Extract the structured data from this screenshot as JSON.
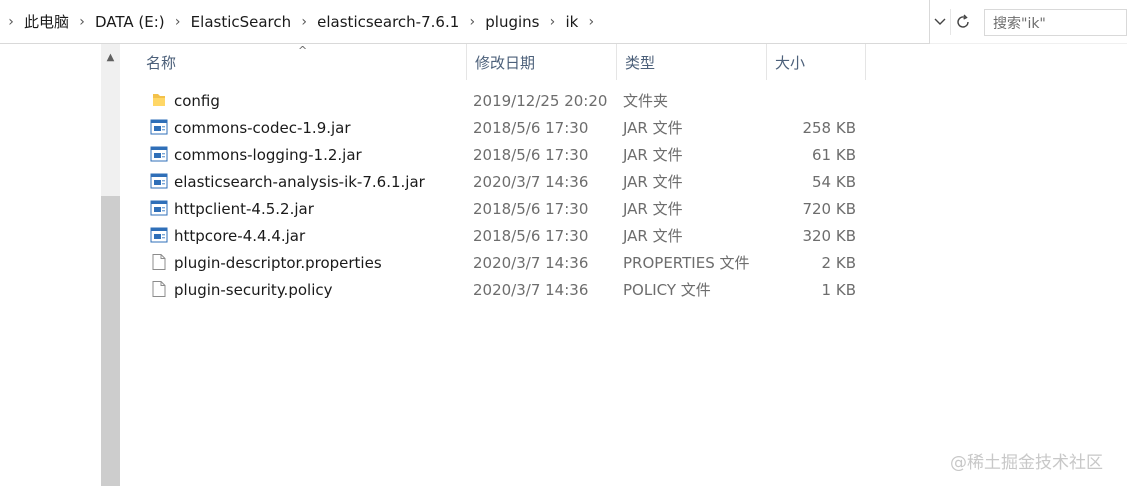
{
  "breadcrumb": [
    "此电脑",
    "DATA (E:)",
    "ElasticSearch",
    "elasticsearch-7.6.1",
    "plugins",
    "ik"
  ],
  "search": {
    "placeholder": "搜索\"ik\""
  },
  "columns": {
    "name": "名称",
    "date": "修改日期",
    "type": "类型",
    "size": "大小"
  },
  "files": [
    {
      "name": "config",
      "date": "2019/12/25 20:20",
      "type": "文件夹",
      "size": "",
      "icon": "folder-icon"
    },
    {
      "name": "commons-codec-1.9.jar",
      "date": "2018/5/6 17:30",
      "type": "JAR 文件",
      "size": "258 KB",
      "icon": "jar-file-icon"
    },
    {
      "name": "commons-logging-1.2.jar",
      "date": "2018/5/6 17:30",
      "type": "JAR 文件",
      "size": "61 KB",
      "icon": "jar-file-icon"
    },
    {
      "name": "elasticsearch-analysis-ik-7.6.1.jar",
      "date": "2020/3/7 14:36",
      "type": "JAR 文件",
      "size": "54 KB",
      "icon": "jar-file-icon"
    },
    {
      "name": "httpclient-4.5.2.jar",
      "date": "2018/5/6 17:30",
      "type": "JAR 文件",
      "size": "720 KB",
      "icon": "jar-file-icon"
    },
    {
      "name": "httpcore-4.4.4.jar",
      "date": "2018/5/6 17:30",
      "type": "JAR 文件",
      "size": "320 KB",
      "icon": "jar-file-icon"
    },
    {
      "name": "plugin-descriptor.properties",
      "date": "2020/3/7 14:36",
      "type": "PROPERTIES 文件",
      "size": "2 KB",
      "icon": "document-icon"
    },
    {
      "name": "plugin-security.policy",
      "date": "2020/3/7 14:36",
      "type": "POLICY 文件",
      "size": "1 KB",
      "icon": "document-icon"
    }
  ],
  "watermark": "@稀土掘金技术社区"
}
